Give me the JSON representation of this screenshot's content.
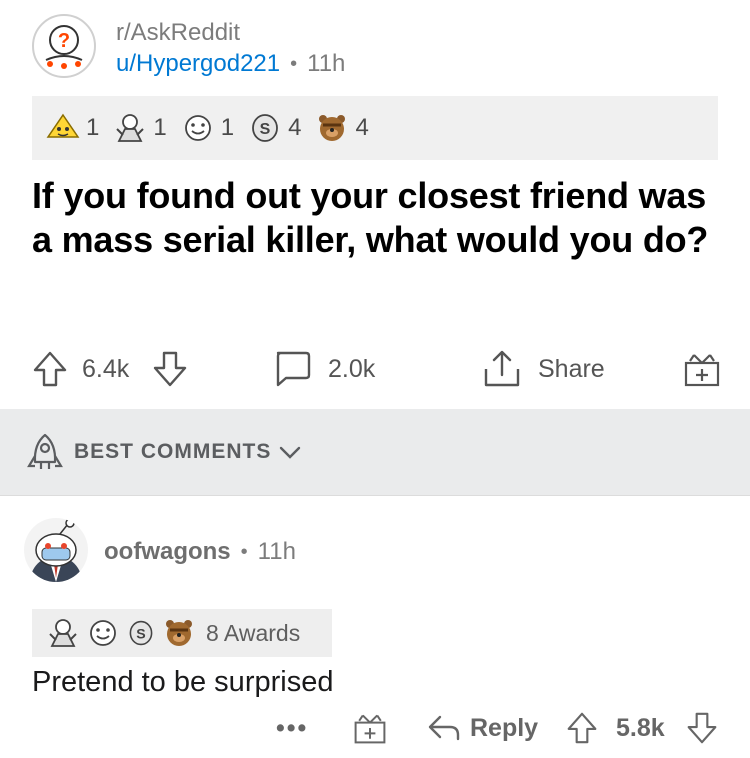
{
  "post": {
    "subreddit": "r/AskReddit",
    "author": "u/Hypergod221",
    "separator": "•",
    "age": "11h",
    "title": "If you found out your closest friend was a mass serial killer, what would you do?",
    "awards": [
      {
        "icon": "helpful-award-icon",
        "count": "1"
      },
      {
        "icon": "take-my-energy-award-icon",
        "count": "1"
      },
      {
        "icon": "wholesome-award-icon",
        "count": "1"
      },
      {
        "icon": "silver-award-icon",
        "count": "4"
      },
      {
        "icon": "facepalm-bear-award-icon",
        "count": "4"
      }
    ],
    "actions": {
      "upvotes": "6.4k",
      "comments": "2.0k",
      "share": "Share"
    }
  },
  "sort": {
    "label": "BEST COMMENTS"
  },
  "comment": {
    "author": "oofwagons",
    "separator": "•",
    "age": "11h",
    "awards_label": "8 Awards",
    "body": "Pretend to be surprised",
    "actions": {
      "more": "•••",
      "reply": "Reply",
      "score": "5.8k"
    }
  },
  "colors": {
    "link": "#0079d3",
    "muted": "#7c7c7c",
    "award_bg": "#f0f0f0",
    "sort_bg": "#eaebec"
  }
}
